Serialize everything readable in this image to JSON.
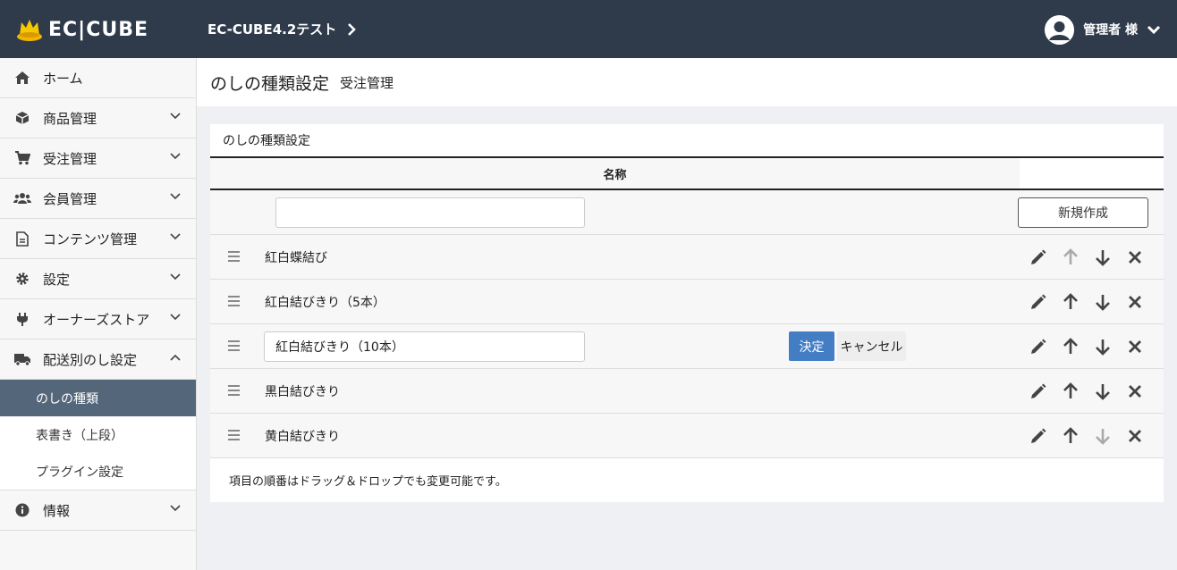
{
  "header": {
    "logo_text": "EC|CUBE",
    "shop_name": "EC-CUBE4.2テスト",
    "user_label": "管理者 様"
  },
  "sidebar": {
    "items": [
      {
        "label": "ホーム",
        "icon": "home-icon"
      },
      {
        "label": "商品管理",
        "icon": "cube-icon"
      },
      {
        "label": "受注管理",
        "icon": "cart-icon"
      },
      {
        "label": "会員管理",
        "icon": "users-icon"
      },
      {
        "label": "コンテンツ管理",
        "icon": "file-icon"
      },
      {
        "label": "設定",
        "icon": "gear-icon"
      },
      {
        "label": "オーナーズストア",
        "icon": "plug-icon"
      },
      {
        "label": "配送別のし設定",
        "icon": "truck-icon"
      }
    ],
    "sub_items": [
      {
        "label": "のしの種類",
        "active": true
      },
      {
        "label": "表書き（上段）",
        "active": false
      },
      {
        "label": "プラグイン設定",
        "active": false
      }
    ],
    "info_item": {
      "label": "情報",
      "icon": "info-icon"
    }
  },
  "page": {
    "title": "のしの種類設定",
    "subtitle": "受注管理"
  },
  "card": {
    "title": "のしの種類設定",
    "column_name": "名称",
    "new_input_value": "",
    "new_button": "新規作成",
    "rows": [
      {
        "name": "紅白蝶結び",
        "up_enabled": false,
        "down_enabled": true
      },
      {
        "name": "紅白結びきり（5本）",
        "up_enabled": true,
        "down_enabled": true
      },
      {
        "name": "紅白結びきり（10本）",
        "editing": true,
        "up_enabled": true,
        "down_enabled": true
      },
      {
        "name": "黒白結びきり",
        "up_enabled": true,
        "down_enabled": true
      },
      {
        "name": "黄白結びきり",
        "up_enabled": true,
        "down_enabled": false
      }
    ],
    "ok_button": "決定",
    "cancel_button": "キャンセル",
    "footer_note": "項目の順番はドラッグ＆ドロップでも変更可能です。"
  },
  "colors": {
    "header_bg": "#2f3b4b",
    "active_nav_bg": "#54667a",
    "primary_button": "#437ec4"
  }
}
